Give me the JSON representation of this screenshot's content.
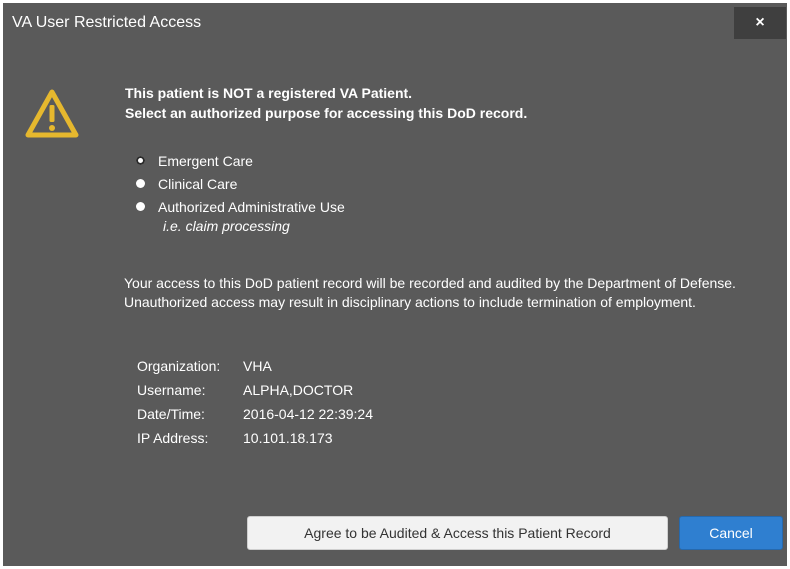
{
  "dialog": {
    "title": "VA User Restricted Access",
    "close_label": "×"
  },
  "icons": {
    "warning": "warning-triangle-icon",
    "close": "close-icon"
  },
  "colors": {
    "dialog_bg": "#5a5a5a",
    "warning": "#e6b82e",
    "primary_button": "#2f7fd0"
  },
  "heading": {
    "line1": "This patient is NOT a registered VA Patient.",
    "line2": "Select an authorized purpose for accessing this DoD record."
  },
  "purpose_options": {
    "selected": "Emergent Care",
    "items": [
      {
        "label": "Emergent Care"
      },
      {
        "label": "Clinical Care"
      },
      {
        "label": "Authorized Administrative Use"
      }
    ],
    "note": "i.e. claim processing"
  },
  "notice": "Your access to this DoD patient record will be recorded and audited by the Department of Defense. Unauthorized access may result in disciplinary actions to include termination of employment.",
  "audit_info": {
    "organization_label": "Organization:",
    "organization": "VHA",
    "username_label": "Username:",
    "username": "ALPHA,DOCTOR",
    "datetime_label": "Date/Time:",
    "datetime": "2016-04-12 22:39:24",
    "ip_label": "IP Address:",
    "ip": "10.101.18.173"
  },
  "buttons": {
    "agree": "Agree to be Audited & Access this Patient Record",
    "cancel": "Cancel"
  }
}
